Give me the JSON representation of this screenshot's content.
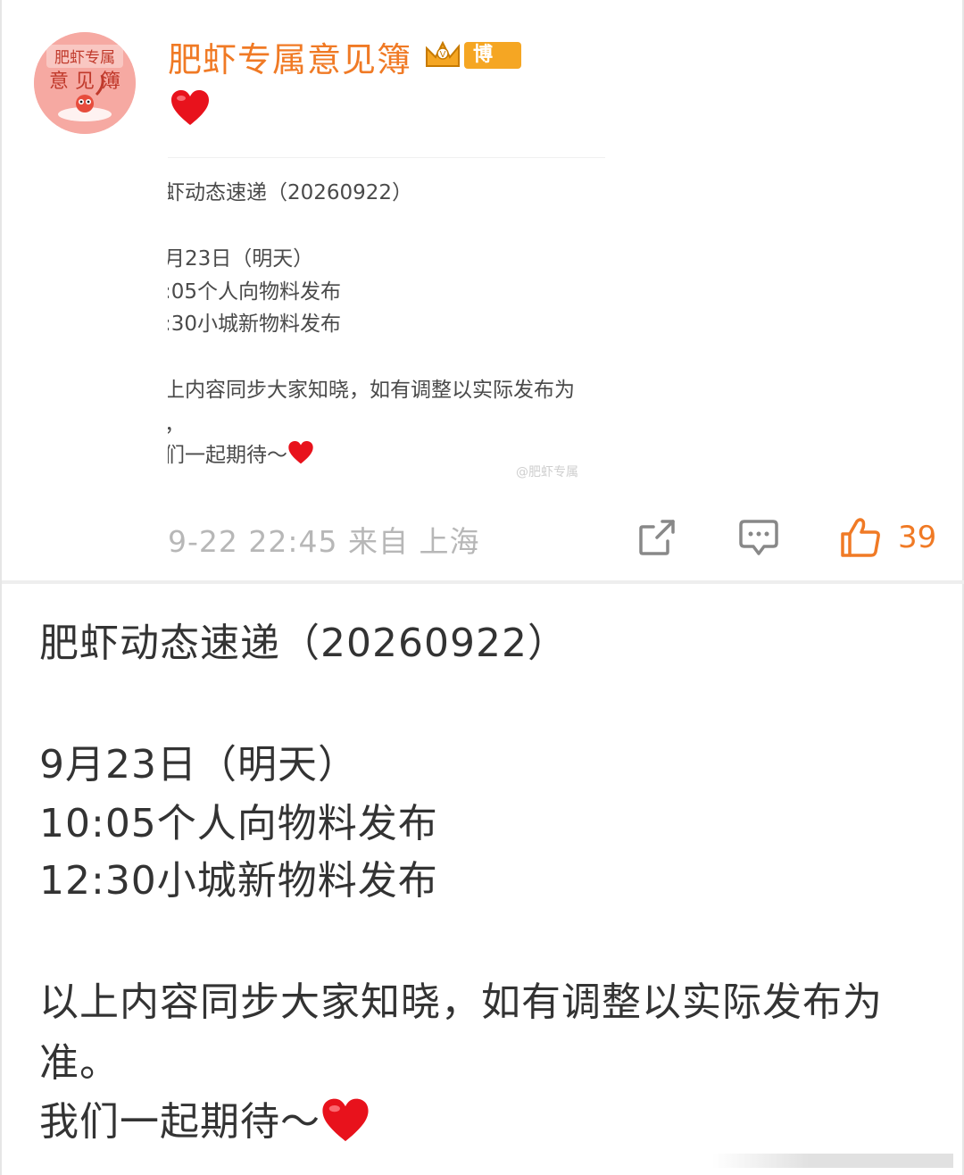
{
  "post": {
    "author_name": "肥虾专属意见簿",
    "avatar_text": "肥虾专属 意见簿",
    "badge_label": "博主",
    "heart_icon": "red-heart-emoji",
    "embedded_lines": [
      "虾动态速递（20260922）",
      "",
      "月23日（明天）",
      ":05个人向物料发布",
      ":30小城新物料发布",
      "",
      "上内容同步大家知晓，如有调整以实际发布为",
      "，",
      "们一起期待～"
    ],
    "embedded_watermark": "@肥虾专属",
    "meta": "9-22 22:45  来自 上海",
    "actions": {
      "share_icon": "share-icon",
      "comment_icon": "comment-icon",
      "like_icon": "thumbs-up-icon",
      "like_count": "39"
    }
  },
  "body": {
    "title": "肥虾动态速递（20260922）",
    "date_line": "9月23日（明天）",
    "item1": "10:05个人向物料发布",
    "item2": "12:30小城新物料发布",
    "notice_line1": "以上内容同步大家知晓，如有调整以实际发布为",
    "notice_line2": "准。",
    "closing": "我们一起期待～"
  },
  "colors": {
    "brand_orange": "#f07a25",
    "badge_orange": "#f5a623",
    "meta_gray": "#b7b7b7",
    "heart_red": "#e8121c"
  }
}
